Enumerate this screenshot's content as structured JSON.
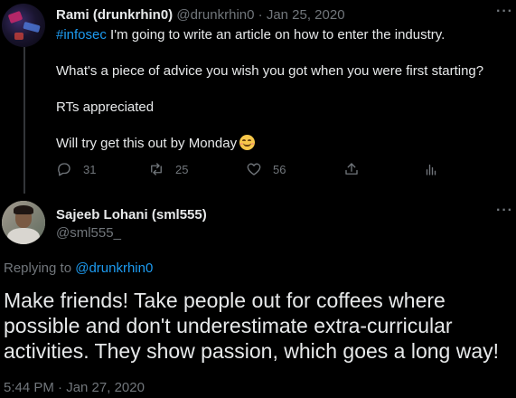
{
  "parent_tweet": {
    "author_name": "Rami (drunkrhin0)",
    "author_handle": "@drunkrhin0",
    "separator": "·",
    "date": "Jan 25, 2020",
    "hashtag": "#infosec",
    "line1_rest": " I'm going to write an article on how to enter the industry.",
    "line2": "What's a piece of advice you wish you got when you were first starting?",
    "line3": "RTs appreciated",
    "line4": "Will try get this out by Monday",
    "emoji": "smiling-face-emoji",
    "more_icon": "more-options-icon",
    "counts": {
      "replies": "31",
      "retweets": "25",
      "likes": "56"
    }
  },
  "reply_tweet": {
    "author_name": "Sajeeb Lohani (sml555)",
    "author_handle": "@sml555_",
    "replying_prefix": "Replying to ",
    "replying_to": "@drunkrhin0",
    "text_lines": [
      "Make friends! Take people out for coffees where",
      "possible and don't underestimate extra-curricular",
      "activities. They show passion, which goes a long way!"
    ],
    "timestamp": "5:44 PM · Jan 27, 2020"
  },
  "colors": {
    "background": "#000000",
    "text": "#e7e9ea",
    "muted": "#71767b",
    "accent": "#1d9bf0"
  }
}
